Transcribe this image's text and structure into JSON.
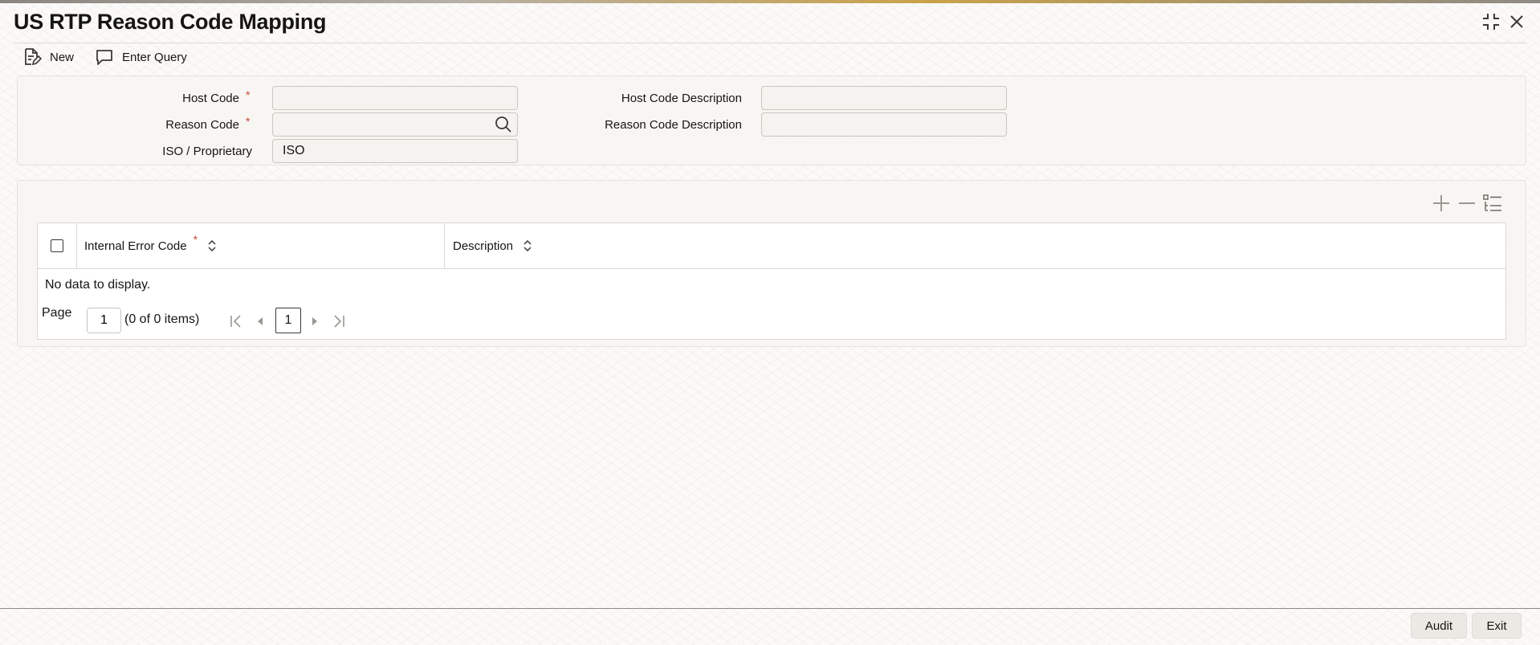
{
  "window": {
    "title": "US RTP Reason Code Mapping",
    "maximize_icon": "compress-icon",
    "close_icon": "close-icon"
  },
  "toolbar": {
    "new_label": "New",
    "enter_query_label": "Enter Query"
  },
  "form": {
    "host_code": {
      "label": "Host Code",
      "required_mark": "*",
      "value": ""
    },
    "reason_code": {
      "label": "Reason Code",
      "required_mark": "*",
      "value": ""
    },
    "iso_proprietary": {
      "label": "ISO / Proprietary",
      "value": "ISO"
    },
    "host_code_description": {
      "label": "Host Code Description",
      "value": ""
    },
    "reason_code_description": {
      "label": "Reason Code Description",
      "value": ""
    }
  },
  "grid": {
    "columns": [
      {
        "label": "Internal Error Code",
        "required_mark": "*"
      },
      {
        "label": "Description"
      }
    ],
    "empty_text": "No data to display.",
    "pager": {
      "page_label": "Page",
      "page_input": "1",
      "items_text": "(0 of 0 items)",
      "current_page": "1"
    }
  },
  "footer": {
    "audit_label": "Audit",
    "exit_label": "Exit"
  },
  "colors": {
    "required": "#c74634",
    "text": "#161513"
  }
}
